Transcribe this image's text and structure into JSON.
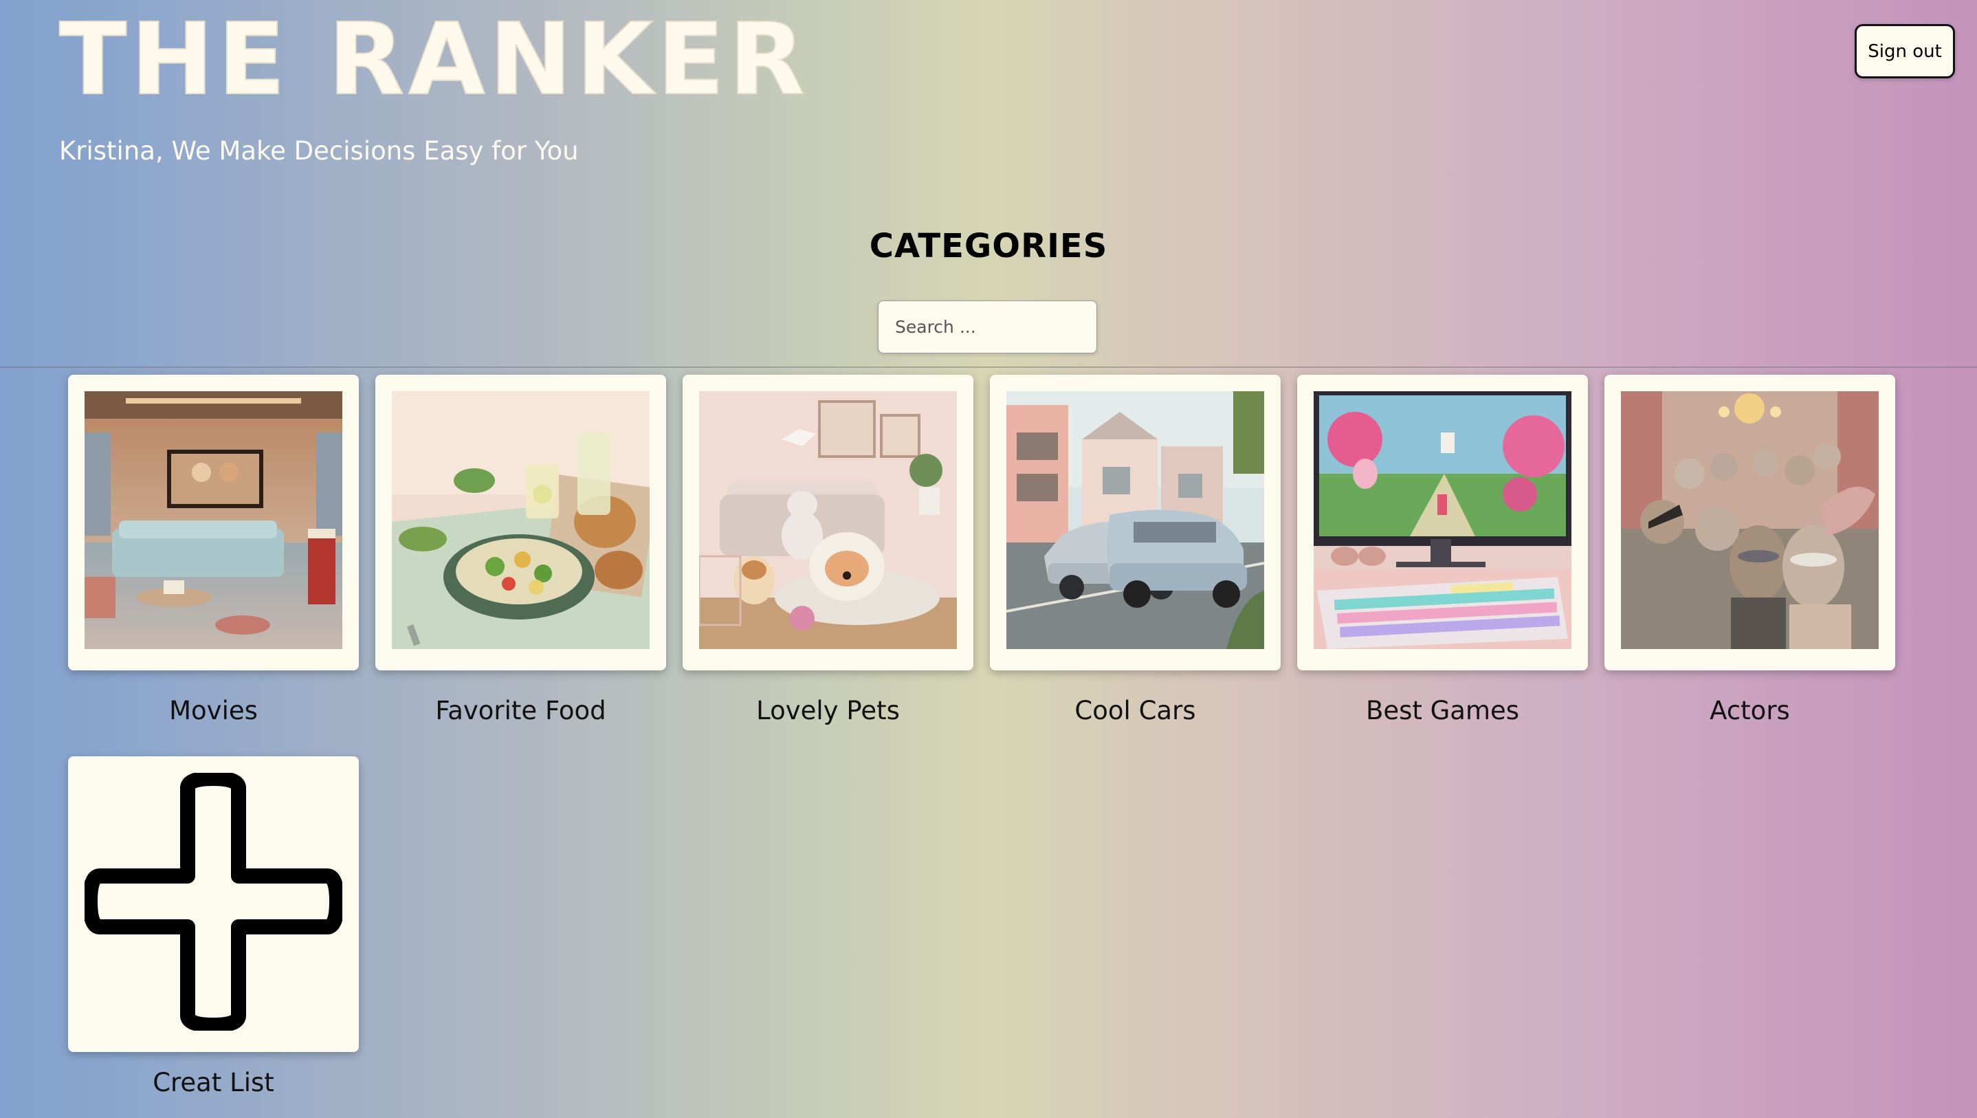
{
  "header": {
    "logo_text": "THE RANKER",
    "tagline": "Kristina, We Make Decisions Easy for You",
    "signout_label": "Sign out"
  },
  "main": {
    "section_title": "CATEGORIES",
    "search": {
      "placeholder": "Search ...",
      "value": ""
    },
    "categories": [
      {
        "label": "Movies",
        "icon": "living-room-home-theater-image"
      },
      {
        "label": "Favorite Food",
        "icon": "salad-and-lemonade-image"
      },
      {
        "label": "Lovely Pets",
        "icon": "puppies-and-kitten-image"
      },
      {
        "label": "Cool Cars",
        "icon": "electric-cars-street-image"
      },
      {
        "label": "Best Games",
        "icon": "gaming-monitor-keyboard-image"
      },
      {
        "label": "Actors",
        "icon": "masquerade-crowd-image"
      }
    ],
    "create_card": {
      "label": "Creat List",
      "icon": "plus-icon"
    }
  }
}
